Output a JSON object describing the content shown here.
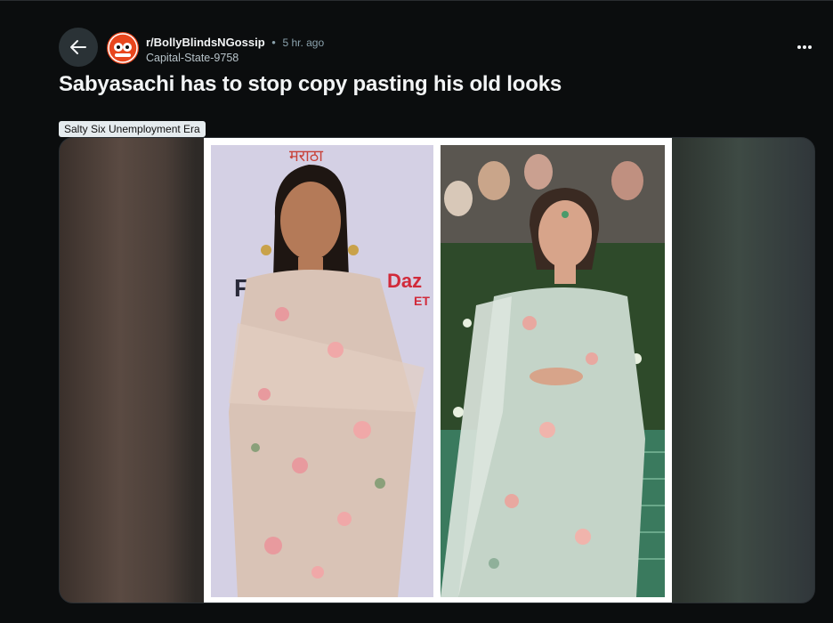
{
  "header": {
    "back_icon": "arrow-left-icon",
    "subreddit": "r/BollyBlindsNGossip",
    "separator": "•",
    "time": "5 hr. ago",
    "author": "Capital-State-9758",
    "more_icon": "more-horizontal-icon"
  },
  "post": {
    "title": "Sabyasachi has to stop copy pasting his old looks",
    "flair": "Salty Six Unemployment Era"
  },
  "image": {
    "left_banner_text": "मराठा",
    "left_logo_text": "Daz",
    "left_logo_sub": "ET",
    "left_wall_text": "F"
  },
  "colors": {
    "accent": "#e8461d",
    "background": "#0b0d0e"
  }
}
